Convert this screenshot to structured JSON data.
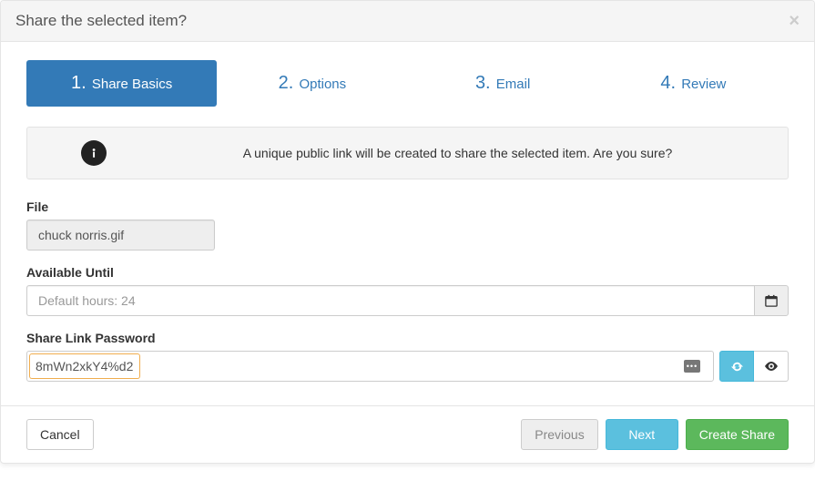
{
  "header": {
    "title": "Share the selected item?",
    "close_glyph": "×"
  },
  "wizard": {
    "steps": [
      {
        "num": "1.",
        "label": "Share Basics",
        "active": true
      },
      {
        "num": "2.",
        "label": "Options",
        "active": false
      },
      {
        "num": "3.",
        "label": "Email",
        "active": false
      },
      {
        "num": "4.",
        "label": "Review",
        "active": false
      }
    ]
  },
  "info": {
    "message": "A unique public link will be created to share the selected item. Are you sure?"
  },
  "form": {
    "file": {
      "label": "File",
      "value": "chuck norris.gif"
    },
    "available_until": {
      "label": "Available Until",
      "placeholder": "Default hours: 24",
      "value": ""
    },
    "password": {
      "label": "Share Link Password",
      "value": "8mWn2xkY4%d2",
      "dots_glyph": "•••"
    }
  },
  "footer": {
    "cancel": "Cancel",
    "previous": "Previous",
    "next": "Next",
    "create": "Create Share"
  }
}
